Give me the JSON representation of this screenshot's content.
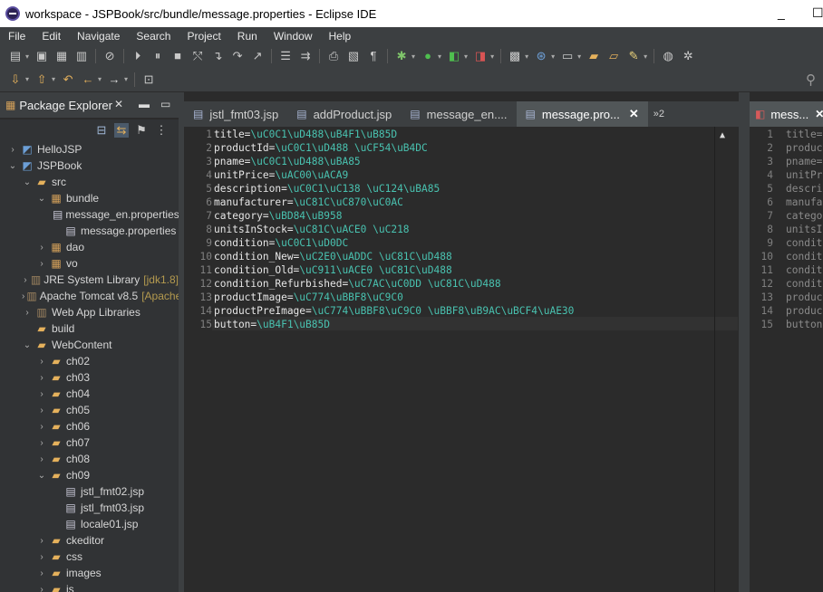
{
  "window": {
    "title": "workspace - JSPBook/src/bundle/message.properties - Eclipse IDE",
    "min_label": "_",
    "max_label": "☐"
  },
  "menu": [
    "File",
    "Edit",
    "Navigate",
    "Search",
    "Project",
    "Run",
    "Window",
    "Help"
  ],
  "package_explorer": {
    "title": "Package Explorer",
    "close_label": "✕",
    "tree": [
      {
        "label": "HelloJSP",
        "depth": 0,
        "arrow": "›",
        "icon": "project-icon"
      },
      {
        "label": "JSPBook",
        "depth": 0,
        "arrow": "⌄",
        "icon": "project-icon"
      },
      {
        "label": "src",
        "depth": 1,
        "arrow": "⌄",
        "icon": "folder-icon"
      },
      {
        "label": "bundle",
        "depth": 2,
        "arrow": "⌄",
        "icon": "package-icon"
      },
      {
        "label": "message_en.properties",
        "depth": 3,
        "arrow": "",
        "icon": "file-icon"
      },
      {
        "label": "message.properties",
        "depth": 3,
        "arrow": "",
        "icon": "file-icon"
      },
      {
        "label": "dao",
        "depth": 2,
        "arrow": "›",
        "icon": "package-icon"
      },
      {
        "label": "vo",
        "depth": 2,
        "arrow": "›",
        "icon": "package-icon"
      },
      {
        "label": "JRE System Library",
        "suffix": "[jdk1.8]",
        "depth": 1,
        "arrow": "›",
        "icon": "library-icon"
      },
      {
        "label": "Apache Tomcat v8.5",
        "suffix": "[Apache]",
        "depth": 1,
        "arrow": "›",
        "icon": "library-icon"
      },
      {
        "label": "Web App Libraries",
        "depth": 1,
        "arrow": "›",
        "icon": "library-icon"
      },
      {
        "label": "build",
        "depth": 1,
        "arrow": "",
        "icon": "folder-icon"
      },
      {
        "label": "WebContent",
        "depth": 1,
        "arrow": "⌄",
        "icon": "folder-icon"
      },
      {
        "label": "ch02",
        "depth": 2,
        "arrow": "›",
        "icon": "folder-icon"
      },
      {
        "label": "ch03",
        "depth": 2,
        "arrow": "›",
        "icon": "folder-icon"
      },
      {
        "label": "ch04",
        "depth": 2,
        "arrow": "›",
        "icon": "folder-icon"
      },
      {
        "label": "ch05",
        "depth": 2,
        "arrow": "›",
        "icon": "folder-icon"
      },
      {
        "label": "ch06",
        "depth": 2,
        "arrow": "›",
        "icon": "folder-icon"
      },
      {
        "label": "ch07",
        "depth": 2,
        "arrow": "›",
        "icon": "folder-icon"
      },
      {
        "label": "ch08",
        "depth": 2,
        "arrow": "›",
        "icon": "folder-icon"
      },
      {
        "label": "ch09",
        "depth": 2,
        "arrow": "⌄",
        "icon": "folder-icon"
      },
      {
        "label": "jstl_fmt02.jsp",
        "depth": 3,
        "arrow": "",
        "icon": "file-icon"
      },
      {
        "label": "jstl_fmt03.jsp",
        "depth": 3,
        "arrow": "",
        "icon": "file-icon"
      },
      {
        "label": "locale01.jsp",
        "depth": 3,
        "arrow": "",
        "icon": "file-icon"
      },
      {
        "label": "ckeditor",
        "depth": 2,
        "arrow": "›",
        "icon": "folder-icon"
      },
      {
        "label": "css",
        "depth": 2,
        "arrow": "›",
        "icon": "folder-icon"
      },
      {
        "label": "images",
        "depth": 2,
        "arrow": "›",
        "icon": "folder-icon"
      },
      {
        "label": "js",
        "depth": 2,
        "arrow": "›",
        "icon": "folder-icon"
      }
    ]
  },
  "editor_tabs": [
    {
      "label": "jstl_fmt03.jsp",
      "active": false
    },
    {
      "label": "addProduct.jsp",
      "active": false
    },
    {
      "label": "message_en....",
      "active": false
    },
    {
      "label": "message.pro...",
      "active": true
    }
  ],
  "overflow_tab": "»2",
  "tab_close": "✕",
  "editor_lines": [
    {
      "n": "1",
      "key": "title=",
      "val": "\\uC0C1\\uD488\\uB4F1\\uB85D"
    },
    {
      "n": "2",
      "key": "productId=",
      "val": "\\uC0C1\\uD488 \\uCF54\\uB4DC"
    },
    {
      "n": "3",
      "key": "pname=",
      "val": "\\uC0C1\\uD488\\uBA85"
    },
    {
      "n": "4",
      "key": "unitPrice=",
      "val": "\\uAC00\\uACA9"
    },
    {
      "n": "5",
      "key": "description=",
      "val": "\\uC0C1\\uC138 \\uC124\\uBA85"
    },
    {
      "n": "6",
      "key": "manufacturer=",
      "val": "\\uC81C\\uC870\\uC0AC"
    },
    {
      "n": "7",
      "key": "category=",
      "val": "\\uBD84\\uB958"
    },
    {
      "n": "8",
      "key": "unitsInStock=",
      "val": "\\uC81C\\uACE0 \\uC218"
    },
    {
      "n": "9",
      "key": "condition=",
      "val": "\\uC0C1\\uD0DC"
    },
    {
      "n": "10",
      "key": "condition_New=",
      "val": "\\uC2E0\\uADDC \\uC81C\\uD488"
    },
    {
      "n": "11",
      "key": "condition_Old=",
      "val": "\\uC911\\uACE0 \\uC81C\\uD488"
    },
    {
      "n": "12",
      "key": "condition_Refurbished=",
      "val": "\\uC7AC\\uC0DD \\uC81C\\uD488"
    },
    {
      "n": "13",
      "key": "productImage=",
      "val": "\\uC774\\uBBF8\\uC9C0"
    },
    {
      "n": "14",
      "key": "productPreImage=",
      "val": "\\uC774\\uBBF8\\uC9C0 \\uBBF8\\uB9AC\\uBCF4\\uAE30"
    },
    {
      "n": "15",
      "key": "button=",
      "val": "\\uB4F1\\uB85D"
    }
  ],
  "right_editor": {
    "tab_label": "mess...",
    "lines": [
      {
        "n": "1",
        "text": "title="
      },
      {
        "n": "2",
        "text": "produc"
      },
      {
        "n": "3",
        "text": "pname="
      },
      {
        "n": "4",
        "text": "unitPr"
      },
      {
        "n": "5",
        "text": "descri"
      },
      {
        "n": "6",
        "text": "manufa"
      },
      {
        "n": "7",
        "text": "catego"
      },
      {
        "n": "8",
        "text": "unitsI"
      },
      {
        "n": "9",
        "text": "condit"
      },
      {
        "n": "10",
        "text": "condit"
      },
      {
        "n": "11",
        "text": "condit"
      },
      {
        "n": "12",
        "text": "condit"
      },
      {
        "n": "13",
        "text": "produc"
      },
      {
        "n": "14",
        "text": "produc"
      },
      {
        "n": "15",
        "text": "button"
      }
    ]
  },
  "colors": {
    "value_text": "#49c2b0",
    "key_text": "#e6e6e6",
    "background": "#2b2b2b"
  }
}
